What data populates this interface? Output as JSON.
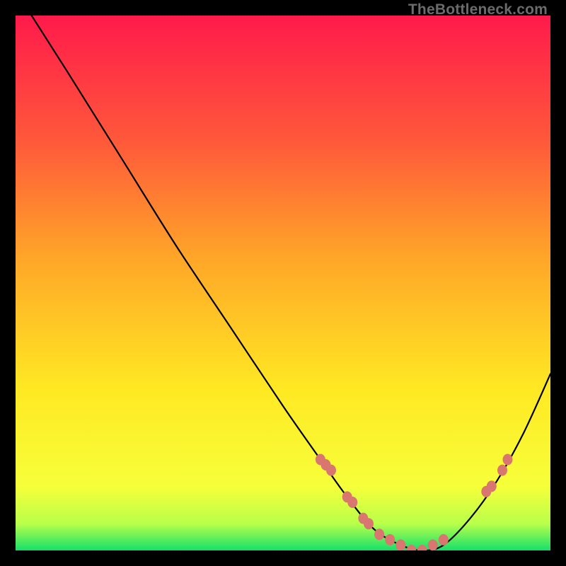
{
  "watermark": "TheBottleneck.com",
  "chart_data": {
    "type": "line",
    "title": "",
    "xlabel": "",
    "ylabel": "",
    "xlim": [
      0,
      100
    ],
    "ylim": [
      0,
      100
    ],
    "grid": false,
    "legend": false,
    "background_gradient": {
      "top_color": "#ff1a4b",
      "mid_color": "#ffe923",
      "bottom_color": "#15e06a"
    },
    "series": [
      {
        "name": "bottleneck-curve",
        "x": [
          3,
          10,
          20,
          30,
          40,
          50,
          57,
          62,
          67,
          72,
          76,
          80,
          85,
          90,
          95,
          100
        ],
        "values": [
          100,
          89,
          73,
          57,
          42,
          27,
          17,
          10,
          4,
          1,
          0,
          1,
          6,
          13,
          22,
          33
        ]
      }
    ],
    "highlighted_points": {
      "name": "markers",
      "x": [
        57,
        58,
        59,
        62,
        63,
        65,
        66,
        68,
        70,
        72,
        74,
        76,
        78,
        80,
        88,
        89,
        91,
        92
      ],
      "values": [
        17,
        16,
        15,
        10,
        9,
        6,
        5,
        3,
        2,
        1,
        0,
        0,
        1,
        2,
        11,
        12,
        15,
        17
      ],
      "color": "#d9766f"
    }
  }
}
